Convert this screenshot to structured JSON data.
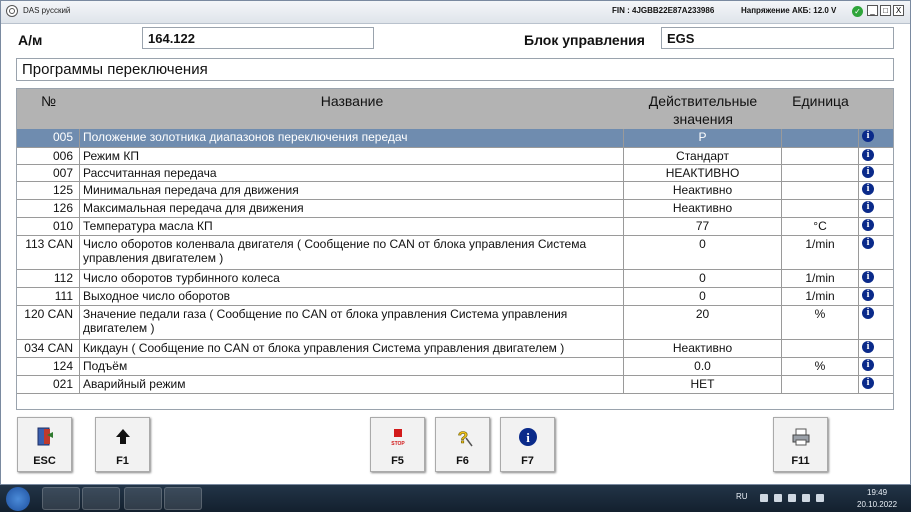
{
  "window": {
    "title": "DAS русский",
    "fin": "FIN : 4JGBB22E87A233986",
    "battery": "Напряжение АКБ: 12.0 V",
    "controls": {
      "minimize": "_",
      "maximize": "□",
      "close": "X"
    }
  },
  "header": {
    "am_label": "А/м",
    "am_value": "164.122",
    "ecu_label": "Блок управления",
    "ecu_value": "EGS"
  },
  "section_title": "Программы переключения",
  "table": {
    "columns": {
      "num": "№",
      "name": "Название",
      "actual_line1": "Действительные",
      "actual_line2": "значения",
      "unit": "Единица"
    },
    "rows": [
      {
        "num": "005",
        "name": "Положение золотника диапазонов переключения передач",
        "value": "P",
        "unit": "",
        "selected": true
      },
      {
        "num": "006",
        "name": "Режим КП",
        "value": "Стандарт",
        "unit": ""
      },
      {
        "num": "007",
        "name": "Рассчитанная передача",
        "value": "НЕАКТИВНО",
        "unit": ""
      },
      {
        "num": "125",
        "name": "Минимальная передача для движения",
        "value": "Неактивно",
        "unit": ""
      },
      {
        "num": "126",
        "name": "Максимальная передача для движения",
        "value": "Неактивно",
        "unit": ""
      },
      {
        "num": "010",
        "name": "Температура масла КП",
        "value": "77",
        "unit": "°C"
      },
      {
        "num": "113 CAN",
        "name": "Число оборотов коленвала двигателя ( Сообщение по CAN от блока управления Система управления двигателем )",
        "value": "0",
        "unit": "1/min"
      },
      {
        "num": "112",
        "name": "Число оборотов турбинного колеса",
        "value": "0",
        "unit": "1/min"
      },
      {
        "num": "111",
        "name": "Выходное число оборотов",
        "value": "0",
        "unit": "1/min"
      },
      {
        "num": "120 CAN",
        "name": "Значение педали газа ( Сообщение по CAN от блока управления Система управления двигателем )",
        "value": "20",
        "unit": "%"
      },
      {
        "num": "034 CAN",
        "name": "Кикдаун ( Сообщение по CAN от блока управления Система управления двигателем )",
        "value": "Неактивно",
        "unit": ""
      },
      {
        "num": "124",
        "name": "Подъём",
        "value": "0.0",
        "unit": "%"
      },
      {
        "num": "021",
        "name": "Аварийный режим",
        "value": "НЕТ",
        "unit": ""
      }
    ]
  },
  "buttons": {
    "esc": "ESC",
    "f1": "F1",
    "f5": "F5",
    "f5_icon_text": "STOP",
    "f6": "F6",
    "f7": "F7",
    "f11": "F11"
  },
  "taskbar": {
    "lang": "RU",
    "time": "19:49",
    "date": "20.10.2022"
  }
}
